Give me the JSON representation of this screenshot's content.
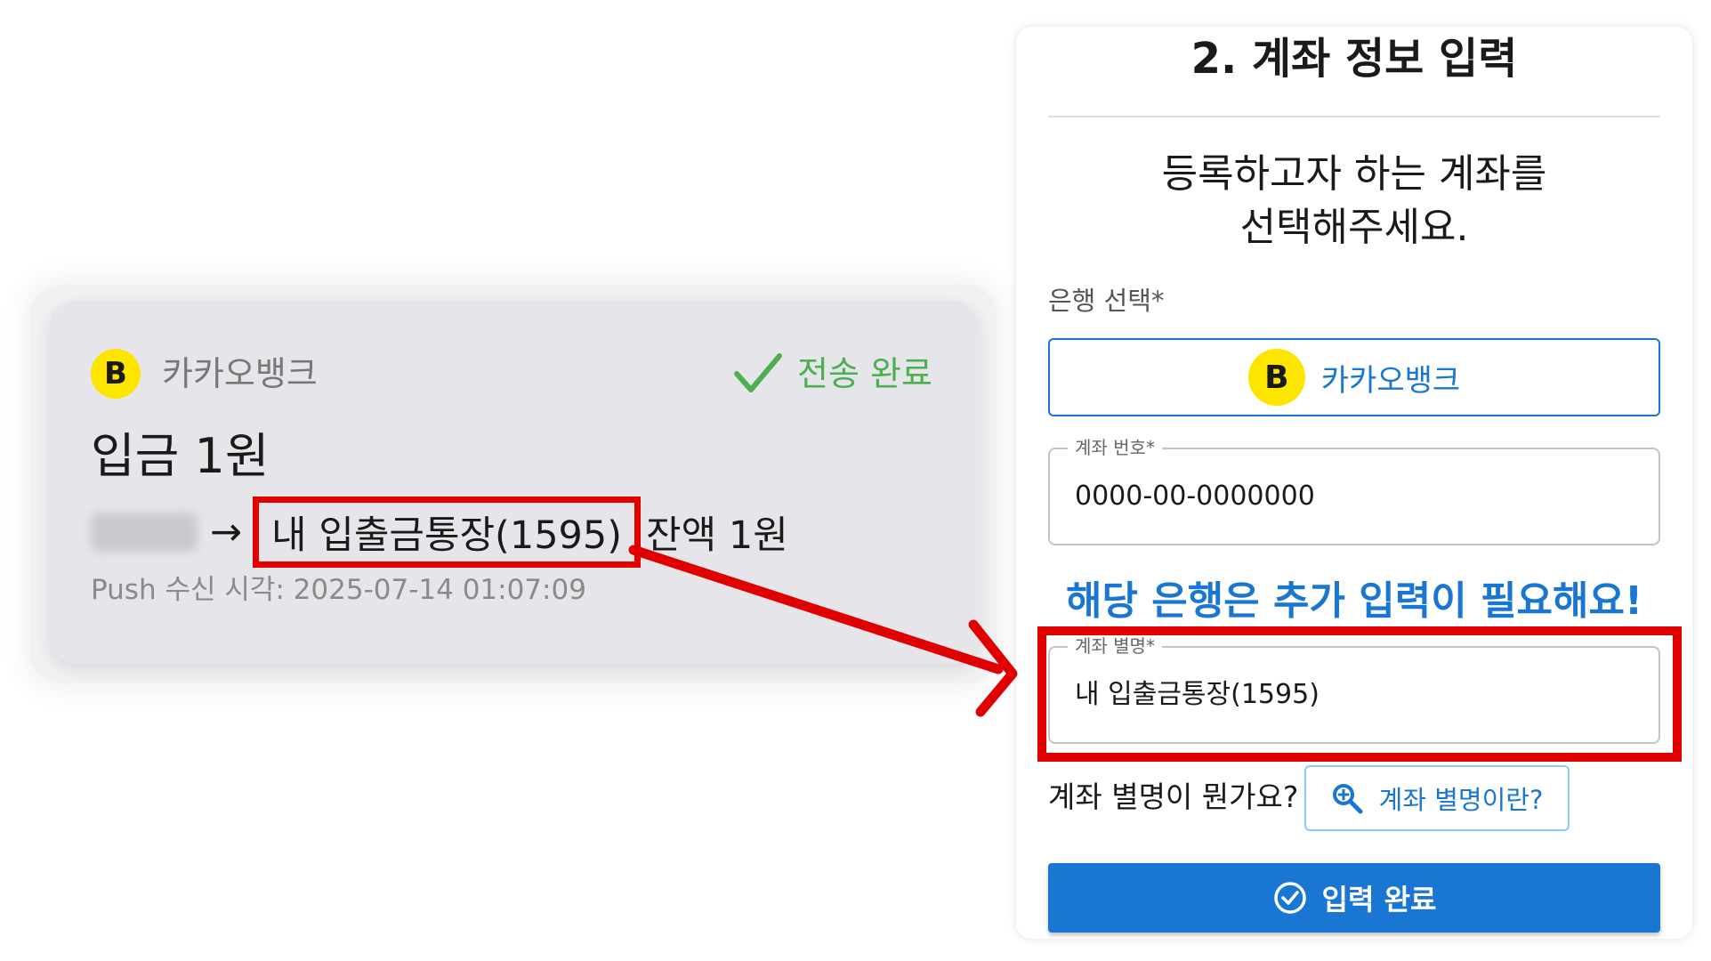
{
  "notification": {
    "bank_name": "카카오뱅크",
    "logo_letter": "B",
    "status": "전송 완료",
    "amount": "입금 1원",
    "arrow": "→",
    "account_name": "내 입출금통장(1595)",
    "balance": "잔액 1원",
    "push_time": "Push 수신 시각: 2025-07-14 01:07:09"
  },
  "form": {
    "title": "2. 계좌 정보 입력",
    "subtitle_line1": "등록하고자 하는 계좌를",
    "subtitle_line2": "선택해주세요.",
    "bank_label": "은행 선택*",
    "bank_selected": "카카오뱅크",
    "account_number_label": "계좌 번호*",
    "account_number_value": "0000-00-0000000",
    "extra_notice": "해당 은행은 추가 입력이 필요해요!",
    "alias_label": "계좌 별명*",
    "alias_value": "내 입출금통장(1595)",
    "alias_question": "계좌 별명이 뭔가요?",
    "alias_help_button": "계좌 별명이란?",
    "submit_button": "입력 완료"
  },
  "colors": {
    "kakao_yellow": "#fee500",
    "primary_blue": "#1976d2",
    "success_green": "#4caf50",
    "highlight_red": "#e00000"
  },
  "icons": {
    "status": "check-icon",
    "help": "search-icon",
    "submit": "check-circle-icon"
  }
}
